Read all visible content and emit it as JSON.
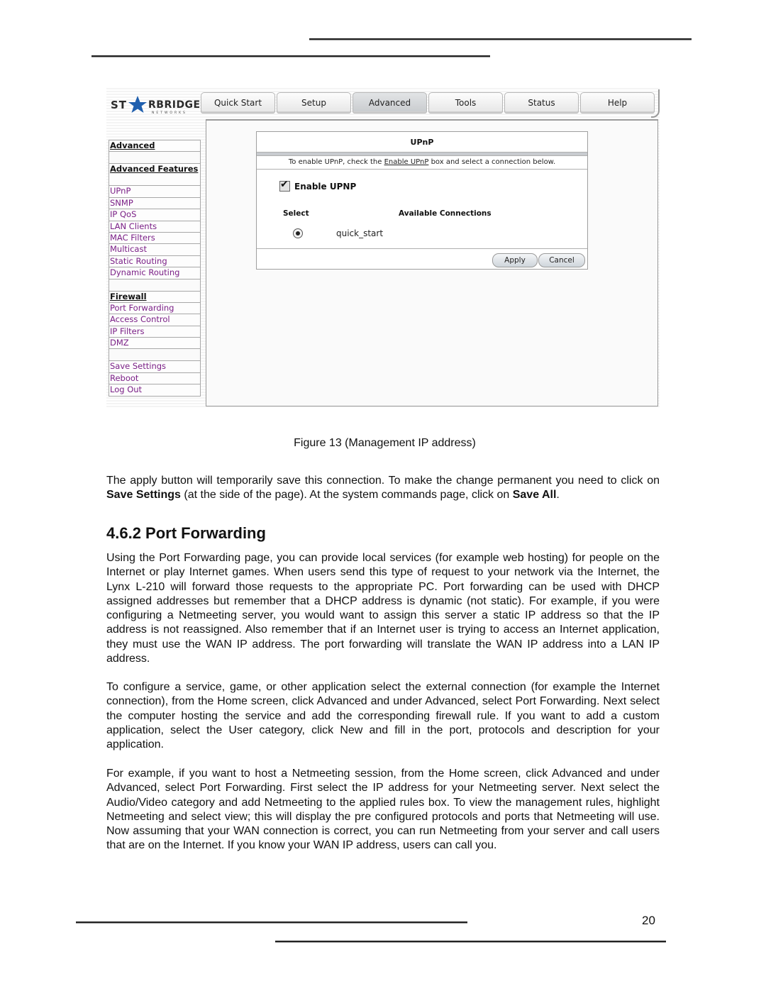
{
  "document": {
    "figure": {
      "logo_alt": "Starbridge Networks",
      "tabs": [
        {
          "label": "Quick Start",
          "active": false
        },
        {
          "label": "Setup",
          "active": false
        },
        {
          "label": "Advanced",
          "active": true
        },
        {
          "label": "Tools",
          "active": false
        },
        {
          "label": "Status",
          "active": false
        },
        {
          "label": "Help",
          "active": false
        }
      ],
      "sidebar": {
        "section_advanced": "Advanced",
        "section_features": "Advanced Features",
        "features_items": [
          "UPnP",
          "SNMP",
          "IP QoS",
          "LAN Clients",
          "MAC Filters",
          "Multicast",
          "Static Routing",
          "Dynamic Routing"
        ],
        "section_firewall": "Firewall",
        "firewall_items": [
          "Port Forwarding",
          "Access Control",
          "IP Filters",
          "DMZ"
        ],
        "system_items": [
          "Save Settings",
          "Reboot",
          "Log Out"
        ]
      },
      "panel": {
        "title": "UPnP",
        "hint_before": "To enable UPnP, check the ",
        "hint_link": "Enable UPnP",
        "hint_after": " box and select a connection below.",
        "enable_label": "Enable UPNP",
        "enable_checked": true,
        "col_select": "Select",
        "col_connections": "Available Connections",
        "connection_name": "quick_start",
        "connection_selected": true,
        "apply_label": "Apply",
        "cancel_label": "Cancel"
      }
    },
    "caption": "Figure 13 (Management IP address)",
    "para1": {
      "t1": "The apply button will temporarily save this connection. To make the change permanent you need to click on ",
      "b1": "Save Settings",
      "t2": " (at the side of the page).  At the system commands page, click on ",
      "b2": "Save All",
      "t3": "."
    },
    "heading": "4.6.2  Port Forwarding",
    "para2": "Using the Port Forwarding page, you can provide local services (for example web hosting) for people on the Internet or play Internet games. When users send this type of request to your network via the Internet, the Lynx L-210 will forward those requests to the appropriate PC. Port forwarding can be used with DHCP assigned addresses but remember that a DHCP address is dynamic (not static).  For example, if you were configuring a Netmeeting server, you would want to assign this server a static IP address so that the IP address is not reassigned.  Also remember that if an Internet user is trying to access an Internet application, they must use the WAN IP address.  The port forwarding will translate the WAN IP address into a LAN IP address.",
    "para3": "To configure a service, game, or other application select the external connection (for example the Internet connection), from the Home screen, click Advanced and under Advanced, select Port Forwarding. Next select the computer hosting the service and add the corresponding firewall rule. If you want to add a custom application, select the User category, click New and fill in the port, protocols and description for your application.",
    "para4": "For example, if you want to host a Netmeeting session, from the Home screen, click Advanced and under Advanced, select Port Forwarding.  First select the IP address for your Netmeeting server. Next select the Audio/Video category and add Netmeeting to the applied rules box.  To view the management rules, highlight Netmeeting and select view; this will display the pre configured protocols and ports that Netmeeting will use.   Now assuming that your WAN connection is correct, you can run Netmeeting from your server and call users that are on the Internet.  If you know your WAN IP address, users can call you.",
    "page_number": "20"
  }
}
